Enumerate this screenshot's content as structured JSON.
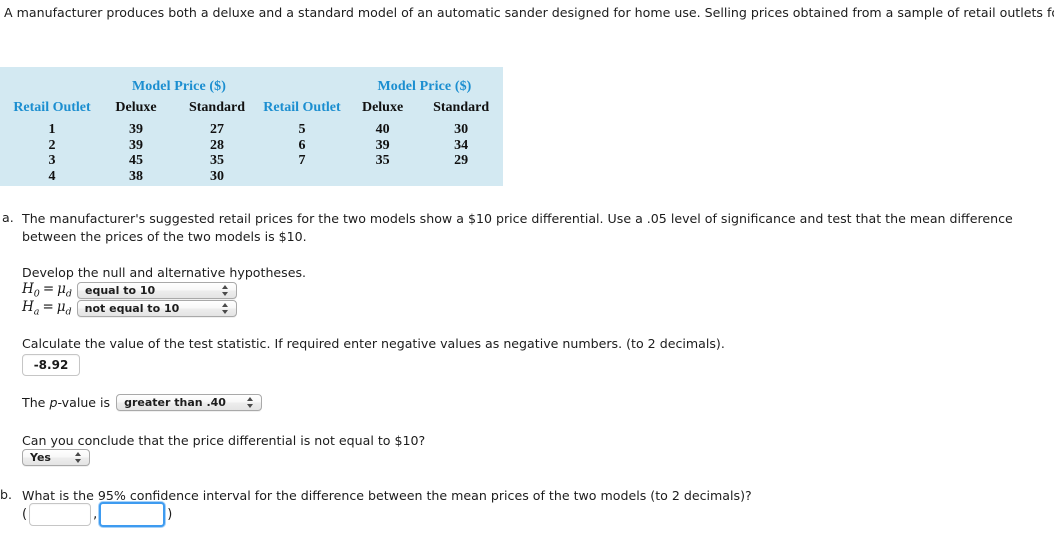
{
  "intro": "A manufacturer produces both a deluxe and a standard model of an automatic sander designed for home use. Selling prices obtained from a sample of retail outlets follow.",
  "table": {
    "group_header": "Model Price ($)",
    "columns": [
      "Retail Outlet",
      "Deluxe",
      "Standard"
    ],
    "left_rows": [
      [
        "1",
        "39",
        "27"
      ],
      [
        "2",
        "39",
        "28"
      ],
      [
        "3",
        "45",
        "35"
      ],
      [
        "4",
        "38",
        "30"
      ]
    ],
    "right_rows": [
      [
        "5",
        "40",
        "30"
      ],
      [
        "6",
        "39",
        "34"
      ],
      [
        "7",
        "35",
        "29"
      ]
    ],
    "background_color": "#d3e9f2",
    "header_accent_color": "#1b8ed0"
  },
  "part_a": {
    "marker": "a.",
    "prompt": "The manufacturer's suggested retail prices for the two models show a $10 price differential. Use a .05 level of significance and test that the mean difference between the prices of the two models is $10.",
    "develop_line": "Develop the null and alternative hypotheses.",
    "h0_symbol": "H",
    "h0_sub": "0",
    "ha_symbol": "H",
    "ha_sub": "a",
    "mu_symbol": "μ",
    "mu_sub": "d",
    "equals": "=",
    "h0_value": "equal to 10",
    "ha_value": "not equal to 10",
    "calc_line": "Calculate the value of the test statistic. If required enter negative values as negative numbers. (to 2 decimals).",
    "test_statistic": "-8.92",
    "pvalue_label_pre": "The ",
    "pvalue_label_ital": "p",
    "pvalue_label_post": "-value is",
    "pvalue_value": "greater than .40",
    "conclusion_question": "Can you conclude that the price differential is not equal to $10?",
    "conclusion_value": "Yes"
  },
  "part_b": {
    "marker": "b.",
    "prompt": "What is the 95% confidence interval for the difference between the mean prices of the two models (to 2 decimals)?",
    "open_paren": "(",
    "comma": ",",
    "close_paren": ")",
    "lower_value": "",
    "upper_value": "",
    "focus_color": "#3e9bf0"
  }
}
